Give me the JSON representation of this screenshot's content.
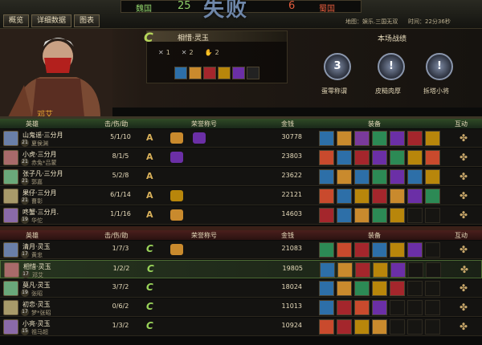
{
  "tabs": [
    "概览",
    "详细数据",
    "图表"
  ],
  "score": {
    "left_name": "魏国",
    "left_score": "25",
    "right_name": "蜀国",
    "right_score": "6",
    "result": "失败"
  },
  "map_info": "地图：娱乐.三国无双",
  "time_info": "时间：22分36秒",
  "current": {
    "title": "相惜·灵玉",
    "rank": "C",
    "kills": "1",
    "deaths": "2",
    "assists": "2",
    "player_name": "邓艾"
  },
  "record": {
    "label": "本场战绩",
    "medals": [
      {
        "num": "3",
        "label": "蛋零称谓"
      },
      {
        "num": "!",
        "label": "皮糙肉厚"
      },
      {
        "num": "!",
        "label": "拆塔小将"
      }
    ]
  },
  "columns": {
    "hero": "英雄",
    "kda": "击/伤/助",
    "honor": "荣誉称号",
    "gold": "金钱",
    "equip": "装备",
    "interact": "互动"
  },
  "team_win": [
    {
      "name": "山鬼谣·三分月",
      "sub": "夏侯渊",
      "level": "21",
      "kda": "5/1/10",
      "rank": "A",
      "gold": "30778",
      "honors": 2,
      "colors": [
        "#2d6fa8",
        "#c98a2d",
        "#7a3a9b",
        "#2c8a55",
        "#6b2fa6",
        "#a4262c",
        "#b8860b"
      ]
    },
    {
      "name": "小虎·三分月",
      "sub": "赤兔*吕蒙",
      "level": "21",
      "kda": "8/1/5",
      "rank": "A",
      "gold": "23803",
      "honors": 1,
      "colors": [
        "#c94a2d",
        "#2d6fa8",
        "#a4262c",
        "#6b2fa6",
        "#2c8a55",
        "#b8860b",
        "#c94a2d"
      ]
    },
    {
      "name": "张子凡·三分月",
      "sub": "郭嘉",
      "level": "21",
      "kda": "5/2/8",
      "rank": "A",
      "gold": "23622",
      "honors": 0,
      "colors": [
        "#2d6fa8",
        "#c98a2d",
        "#2d6fa8",
        "#2c8a55",
        "#6b2fa6",
        "#2d6fa8",
        "#b8860b"
      ]
    },
    {
      "name": "果仔·三分月",
      "sub": "曹彰",
      "level": "21",
      "kda": "6/1/14",
      "rank": "A",
      "gold": "22121",
      "honors": 1,
      "colors": [
        "#c94a2d",
        "#2d6fa8",
        "#b8860b",
        "#a4262c",
        "#c98a2d",
        "#6b2fa6",
        "#2c8a55"
      ]
    },
    {
      "name": "咚蟹·三分月.",
      "sub": "华佗",
      "level": "19",
      "kda": "1/1/16",
      "rank": "A",
      "gold": "14603",
      "honors": 1,
      "colors": [
        "#a4262c",
        "#2d6fa8",
        "#c98a2d",
        "#2c8a55",
        "#b8860b",
        "",
        ""
      ]
    }
  ],
  "team_lose": [
    {
      "name": "清月·灵玉",
      "sub": "黄忠",
      "level": "17",
      "kda": "1/7/3",
      "rank": "C",
      "gold": "21083",
      "honors": 1,
      "colors": [
        "#2c8a55",
        "#c94a2d",
        "#a4262c",
        "#2d6fa8",
        "#b8860b",
        "#6b2fa6",
        ""
      ]
    },
    {
      "name": "相惜·灵玉",
      "sub": "邓艾",
      "level": "17",
      "kda": "1/2/2",
      "rank": "C",
      "gold": "19805",
      "honors": 0,
      "sel": true,
      "colors": [
        "#2d6fa8",
        "#c98a2d",
        "#a4262c",
        "#b8860b",
        "#6b2fa6",
        "",
        ""
      ]
    },
    {
      "name": "莫凡·灵玉",
      "sub": "张昭",
      "level": "19",
      "kda": "3/7/2",
      "rank": "C",
      "gold": "18024",
      "honors": 0,
      "colors": [
        "#2d6fa8",
        "#c98a2d",
        "#2c8a55",
        "#b8860b",
        "#a4262c",
        "",
        ""
      ]
    },
    {
      "name": "初恋·灵玉",
      "sub": "梦*张昭",
      "level": "17",
      "kda": "0/6/2",
      "rank": "C",
      "gold": "11013",
      "honors": 0,
      "colors": [
        "#2d6fa8",
        "#a4262c",
        "#c94a2d",
        "#6b2fa6",
        "",
        "",
        ""
      ]
    },
    {
      "name": "小亮·灵玉",
      "sub": "祖马超",
      "level": "15",
      "kda": "1/3/2",
      "rank": "C",
      "gold": "10924",
      "honors": 0,
      "colors": [
        "#c94a2d",
        "#a4262c",
        "#b8860b",
        "#c98a2d",
        "",
        "",
        ""
      ]
    }
  ]
}
